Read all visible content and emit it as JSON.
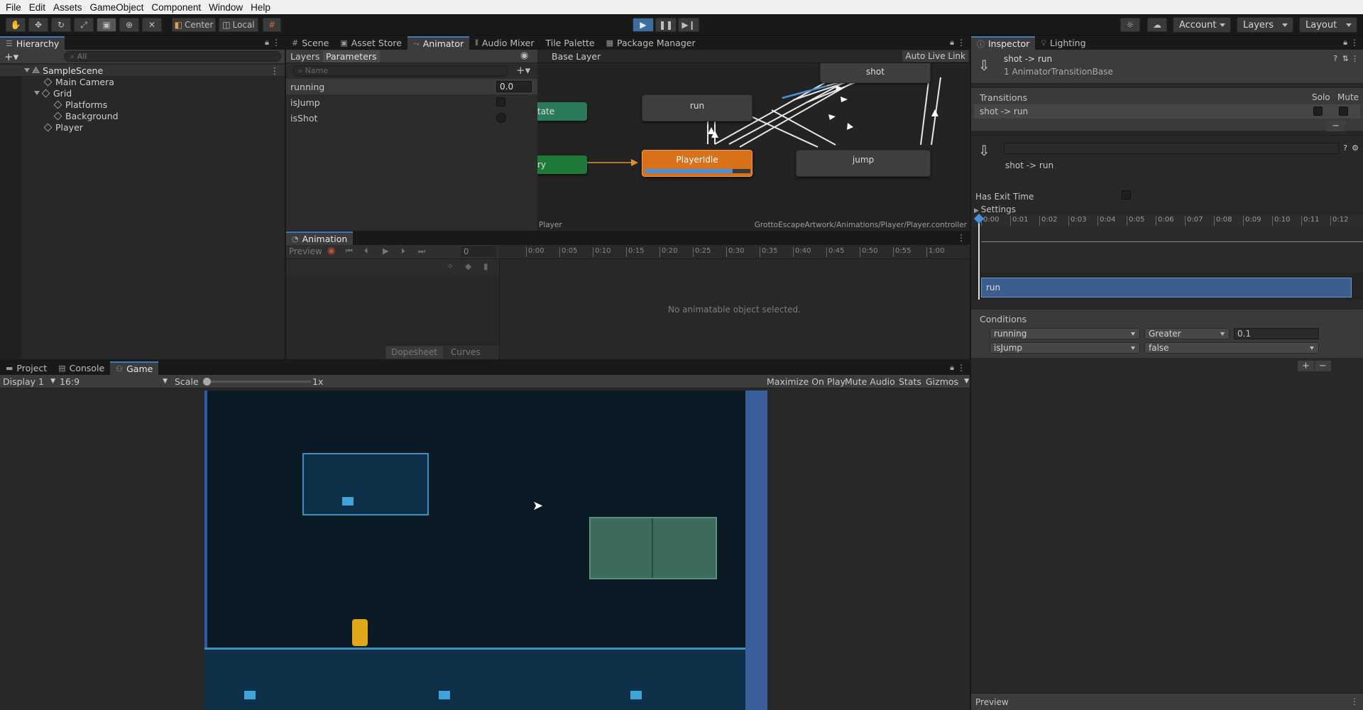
{
  "menu": [
    "File",
    "Edit",
    "Assets",
    "GameObject",
    "Component",
    "Window",
    "Help"
  ],
  "toolbar": {
    "pivot_label": "Center",
    "space_label": "Local",
    "account_label": "Account",
    "layers_label": "Layers",
    "layout_label": "Layout"
  },
  "hierarchy": {
    "tab": "Hierarchy",
    "search_placeholder": "All",
    "scene": "SampleScene",
    "items": [
      "Main Camera",
      "Grid",
      "Platforms",
      "Background",
      "Player"
    ]
  },
  "center_tabs": [
    "Scene",
    "Asset Store",
    "Animator",
    "Audio Mixer",
    "Tile Palette",
    "Package Manager"
  ],
  "animator": {
    "layers_tab": "Layers",
    "parameters_tab": "Parameters",
    "name_placeholder": "Name",
    "base_layer": "Base Layer",
    "auto_live_link": "Auto Live Link",
    "params": [
      {
        "name": "running",
        "value": "0.0"
      },
      {
        "name": "isJump"
      },
      {
        "name": "isShot"
      }
    ],
    "nodes": {
      "shot": "shot",
      "run": "run",
      "state_partial": "tate",
      "entry_partial": "ry",
      "idle": "PlayerIdle",
      "jump": "jump"
    },
    "footer_left": "Player",
    "footer_right": "GrottoEscapeArtwork/Animations/Player/Player.controller",
    "colors": {
      "idle": "#d9701a",
      "state": "#2a7a5c",
      "entry": "#1f7a3a",
      "arrow": "#ffffff",
      "active_arrow": "#4a8fd9"
    }
  },
  "animation": {
    "tab": "Animation",
    "preview": "Preview",
    "frame": "0",
    "ticks": [
      "0:00",
      "0:05",
      "0:10",
      "0:15",
      "0:20",
      "0:25",
      "0:30",
      "0:35",
      "0:40",
      "0:45",
      "0:50",
      "0:55",
      "1:00"
    ],
    "empty_msg": "No animatable object selected.",
    "dopesheet": "Dopesheet",
    "curves": "Curves"
  },
  "bottom_tabs": [
    "Project",
    "Console",
    "Game"
  ],
  "game": {
    "display": "Display 1",
    "aspect": "16:9",
    "scale_label": "Scale",
    "scale_value": "1x",
    "maximize": "Maximize On Play",
    "mute": "Mute Audio",
    "stats": "Stats",
    "gizmos": "Gizmos"
  },
  "inspector": {
    "tabs": [
      "Inspector",
      "Lighting"
    ],
    "title": "shot -> run",
    "subtitle": "1 AnimatorTransitionBase",
    "transitions_label": "Transitions",
    "solo": "Solo",
    "mute": "Mute",
    "transition_item": "shot -> run",
    "transition_name": "shot -> run",
    "has_exit_time": "Has Exit Time",
    "settings": "Settings",
    "timeline_ticks": [
      "0:00",
      "0:01",
      "0:02",
      "0:03",
      "0:04",
      "0:05",
      "0:06",
      "0:07",
      "0:08",
      "0:09",
      "0:10",
      "0:11",
      "0:12"
    ],
    "run_bar": "run",
    "conditions_label": "Conditions",
    "conditions": [
      {
        "param": "running",
        "op": "Greater",
        "value": "0.1"
      },
      {
        "param": "isJump",
        "op": "false"
      }
    ],
    "preview": "Preview"
  }
}
